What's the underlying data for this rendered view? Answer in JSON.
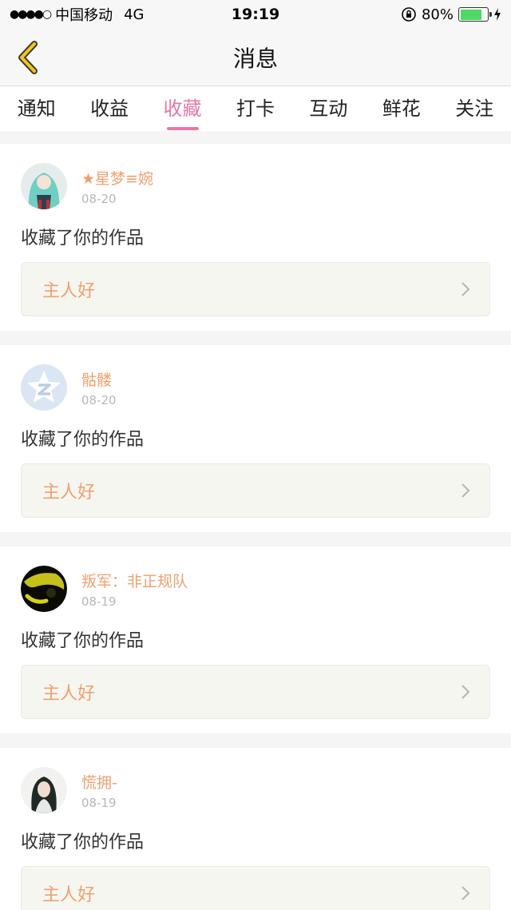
{
  "status_bar": {
    "signal": "●●●●○",
    "carrier": "中国移动",
    "network": "4G",
    "time": "19:19",
    "battery_percent": "80%",
    "battery_level": 0.8
  },
  "nav": {
    "title": "消息"
  },
  "tabs": [
    {
      "label": "通知",
      "active": false
    },
    {
      "label": "收益",
      "active": false
    },
    {
      "label": "收藏",
      "active": true
    },
    {
      "label": "打卡",
      "active": false
    },
    {
      "label": "互动",
      "active": false
    },
    {
      "label": "鲜花",
      "active": false
    },
    {
      "label": "关注",
      "active": false
    }
  ],
  "messages": [
    {
      "username": "★星梦≡婉",
      "date": "08-20",
      "action": "收藏了你的作品",
      "work_title": "主人好",
      "avatar": "anime-girl-avatar"
    },
    {
      "username": "骷髅",
      "date": "08-20",
      "action": "收藏了你的作品",
      "work_title": "主人好",
      "avatar": "qzone-star-avatar"
    },
    {
      "username": "叛军：非正规队",
      "date": "08-19",
      "action": "收藏了你的作品",
      "work_title": "主人好",
      "avatar": "dark-yellow-avatar"
    },
    {
      "username": "慌拥-",
      "date": "08-19",
      "action": "收藏了你的作品",
      "work_title": "主人好",
      "avatar": "girl-portrait-avatar"
    }
  ],
  "colors": {
    "accent_pink": "#e678a8",
    "username_orange": "#f0a070"
  }
}
